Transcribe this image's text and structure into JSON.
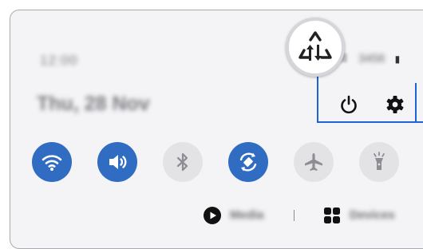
{
  "status_bar": {
    "time": "12:00",
    "date": "Thu, 28 Nov",
    "carrier": "3456"
  },
  "callout": {
    "icon": "data-saver-icon"
  },
  "header_actions": [
    {
      "name": "power-button",
      "icon": "power-icon"
    },
    {
      "name": "settings-button",
      "icon": "gear-icon"
    }
  ],
  "quick_settings": [
    {
      "name": "wifi",
      "icon": "wifi-icon",
      "state": "on"
    },
    {
      "name": "sound",
      "icon": "volume-icon",
      "state": "on"
    },
    {
      "name": "bluetooth",
      "icon": "bluetooth-icon",
      "state": "off"
    },
    {
      "name": "auto-rotate",
      "icon": "rotate-icon",
      "state": "on"
    },
    {
      "name": "airplane-mode",
      "icon": "airplane-icon",
      "state": "off"
    },
    {
      "name": "flashlight",
      "icon": "flashlight-icon",
      "state": "off"
    }
  ],
  "bottom": {
    "media_label": "Media",
    "devices_label": "Devices"
  },
  "colors": {
    "active_tile": "#2f6cc2",
    "inactive_tile": "#e3e3e6",
    "callout_line": "#1e63d6"
  }
}
